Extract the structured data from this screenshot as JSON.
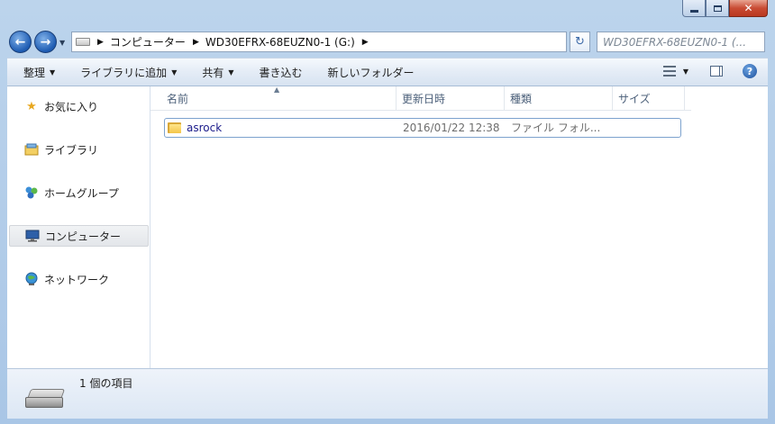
{
  "address": {
    "crumbs": [
      "コンピューター",
      "WD30EFRX-68EUZN0-1 (G:)"
    ]
  },
  "search": {
    "placeholder": "WD30EFRX-68EUZN0-1 (..."
  },
  "toolbar": {
    "items": [
      {
        "label": "整理",
        "dropdown": true
      },
      {
        "label": "ライブラリに追加",
        "dropdown": true
      },
      {
        "label": "共有",
        "dropdown": true
      },
      {
        "label": "書き込む",
        "dropdown": false
      },
      {
        "label": "新しいフォルダー",
        "dropdown": false
      }
    ]
  },
  "nav": {
    "items": [
      {
        "label": "お気に入り",
        "icon": "star-icon"
      },
      {
        "label": "ライブラリ",
        "icon": "library-icon"
      },
      {
        "label": "ホームグループ",
        "icon": "homegroup-icon"
      },
      {
        "label": "コンピューター",
        "icon": "computer-icon",
        "selected": true
      },
      {
        "label": "ネットワーク",
        "icon": "network-icon"
      }
    ]
  },
  "columns": [
    "名前",
    "更新日時",
    "種類",
    "サイズ"
  ],
  "files": [
    {
      "name": "asrock",
      "modified": "2016/01/22 12:38",
      "type": "ファイル フォル...",
      "size": ""
    }
  ],
  "status": {
    "text": "1 個の項目"
  },
  "colors": {
    "accent": "#1d5bb2",
    "window_frame": "#a9c6e6",
    "selection_border": "#7da2ce"
  }
}
